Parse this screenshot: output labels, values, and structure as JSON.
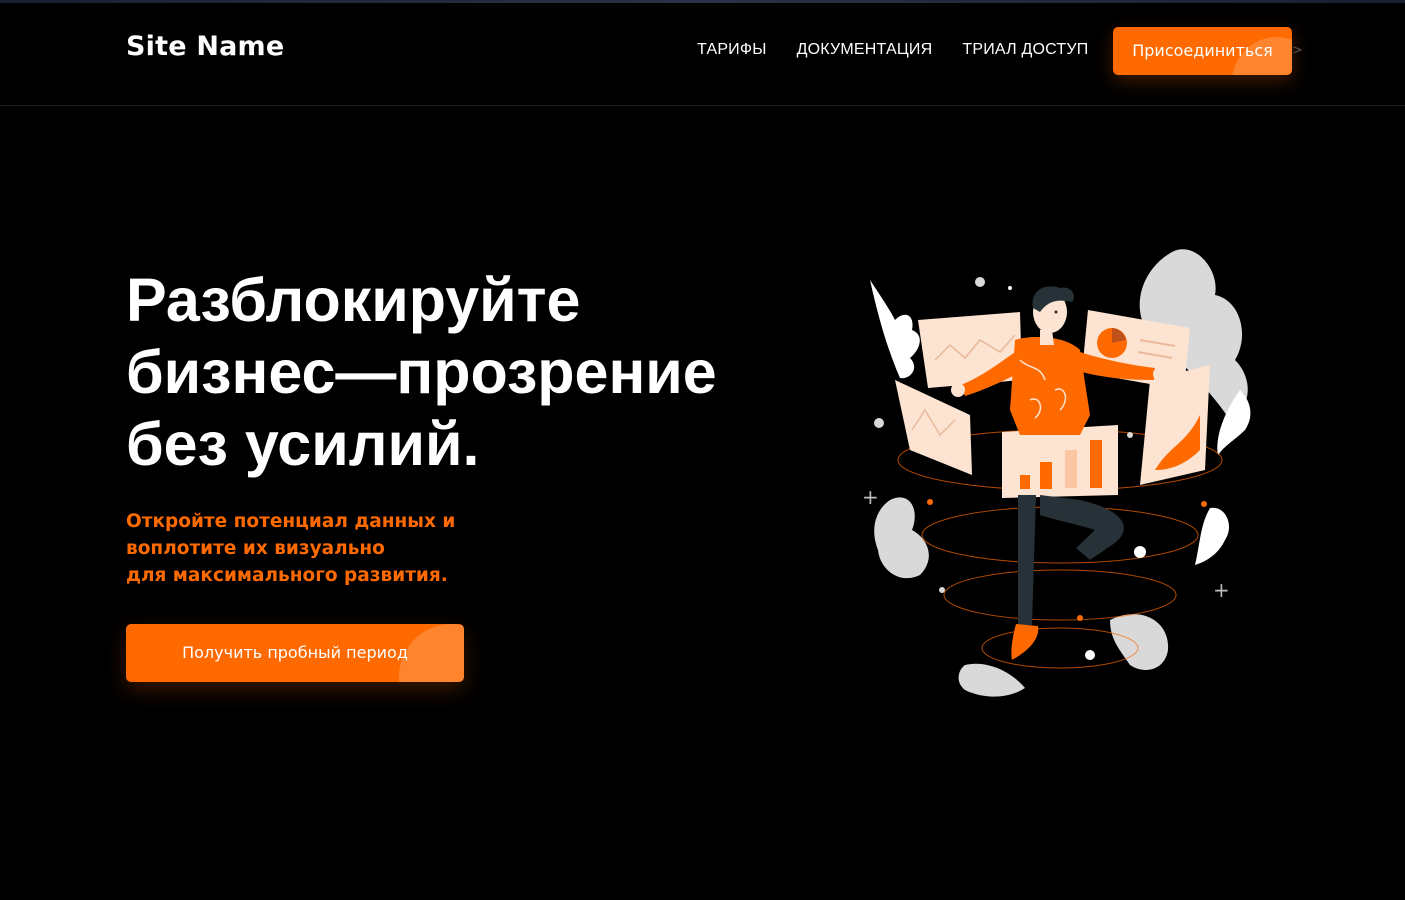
{
  "header": {
    "logo": "Site Name",
    "nav": [
      {
        "label": "ТАРИФЫ"
      },
      {
        "label": "ДОКУМЕНТАЦИЯ"
      },
      {
        "label": "ТРИАЛ ДОСТУП"
      }
    ],
    "join_button": "Присоединиться",
    "join_arrow": ">"
  },
  "hero": {
    "title_lines": [
      "Разблокируйте",
      "бизнес—прозрение",
      "без усилий."
    ],
    "subtitle_lines": [
      "Откройте потенциал данных и",
      "воплотите их визуально",
      "для максимального развития."
    ],
    "cta_button": "Получить пробный период"
  },
  "colors": {
    "accent": "#ff6a00",
    "background": "#000000",
    "text": "#ffffff",
    "panel": "#fde3d1",
    "gray": "#d9d9d9"
  },
  "illustration": {
    "icon": "person-with-data-dashboards-illustration"
  }
}
